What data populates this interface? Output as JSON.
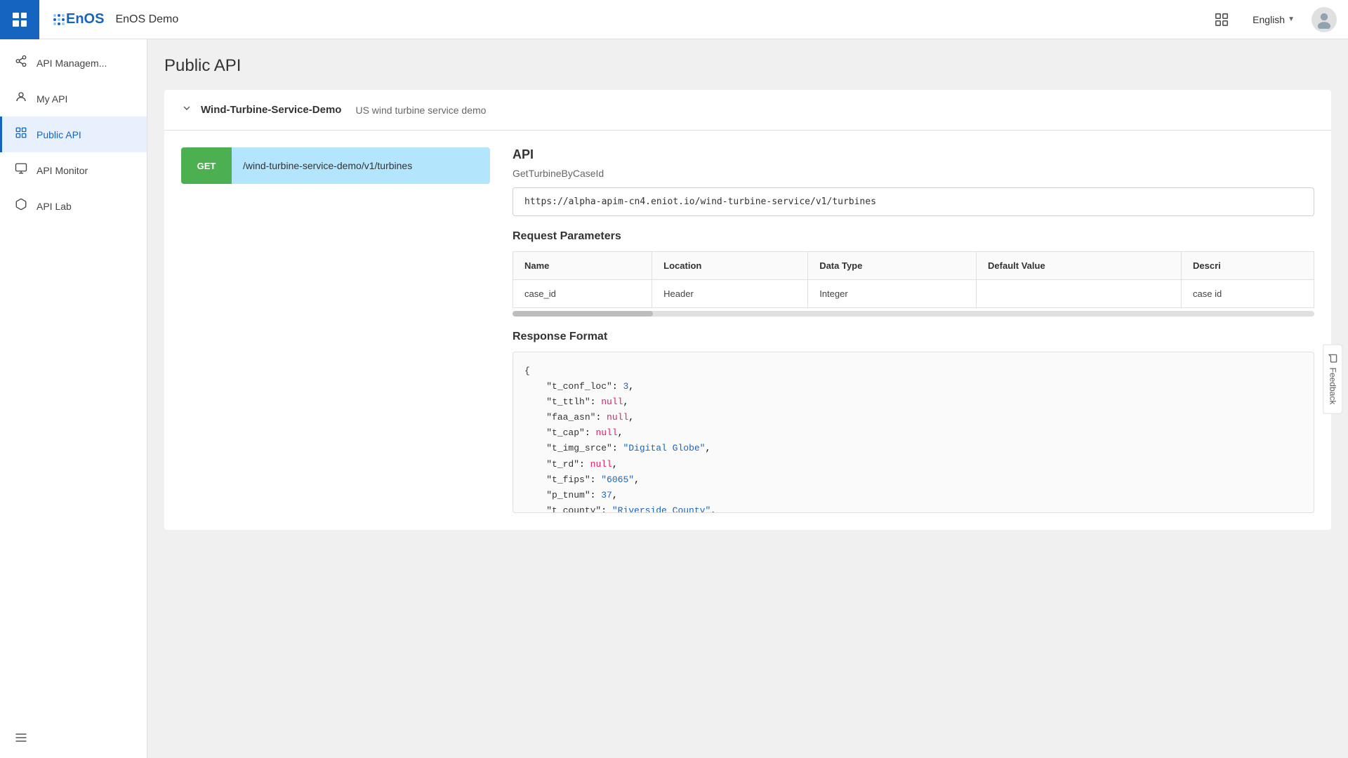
{
  "header": {
    "app_title": "EnOS Demo",
    "lang_label": "English",
    "logo_text": "EnOS"
  },
  "sidebar": {
    "items": [
      {
        "id": "api-management",
        "label": "API Managem...",
        "icon": "share-icon"
      },
      {
        "id": "my-api",
        "label": "My API",
        "icon": "user-icon"
      },
      {
        "id": "public-api",
        "label": "Public API",
        "icon": "grid-icon",
        "active": true
      },
      {
        "id": "api-monitor",
        "label": "API Monitor",
        "icon": "monitor-icon"
      },
      {
        "id": "api-lab",
        "label": "API Lab",
        "icon": "box-icon"
      }
    ],
    "collapse_label": "≡"
  },
  "page": {
    "title": "Public API"
  },
  "service": {
    "name": "Wind-Turbine-Service-Demo",
    "description": "US wind turbine service demo"
  },
  "endpoint": {
    "method": "GET",
    "path": "/wind-turbine-service-demo/v1/turbines"
  },
  "api_detail": {
    "section_title": "API",
    "api_name": "GetTurbineByCaseId",
    "url": "https://alpha-apim-cn4.eniot.io/wind-turbine-service/v1/turbines"
  },
  "request_parameters": {
    "section_title": "Request Parameters",
    "columns": [
      "Name",
      "Location",
      "Data Type",
      "Default Value",
      "Descri"
    ],
    "rows": [
      {
        "name": "case_id",
        "location": "Header",
        "data_type": "Integer",
        "default_value": "",
        "description": "case id"
      }
    ]
  },
  "response_format": {
    "section_title": "Response Format",
    "code_lines": [
      {
        "text": "{",
        "type": "bracket"
      },
      {
        "key": "\"t_conf_loc\"",
        "sep": ": ",
        "value": "3",
        "value_type": "number",
        "trailing": ","
      },
      {
        "key": "\"t_ttlh\"",
        "sep": ": ",
        "value": "null",
        "value_type": "null",
        "trailing": ","
      },
      {
        "key": "\"faa_asn\"",
        "sep": ": ",
        "value": "null",
        "value_type": "null",
        "trailing": ","
      },
      {
        "key": "\"t_cap\"",
        "sep": ": ",
        "value": "null",
        "value_type": "null",
        "trailing": ","
      },
      {
        "key": "\"t_img_srce\"",
        "sep": ": ",
        "value": "\"Digital Globe\"",
        "value_type": "string",
        "trailing": ","
      },
      {
        "key": "\"t_rd\"",
        "sep": ": ",
        "value": "null",
        "value_type": "null",
        "trailing": ","
      },
      {
        "key": "\"t_fips\"",
        "sep": ": ",
        "value": "\"6065\"",
        "value_type": "string",
        "trailing": ","
      },
      {
        "key": "\"p_tnum\"",
        "sep": ": ",
        "value": "37",
        "value_type": "number",
        "trailing": ","
      },
      {
        "key": "\"t_county\"",
        "sep": ": ",
        "value": "\"Riverside County\"",
        "value_type": "string",
        "trailing": ","
      }
    ]
  },
  "feedback": {
    "label": "Feedback",
    "icon": "chat-icon"
  }
}
